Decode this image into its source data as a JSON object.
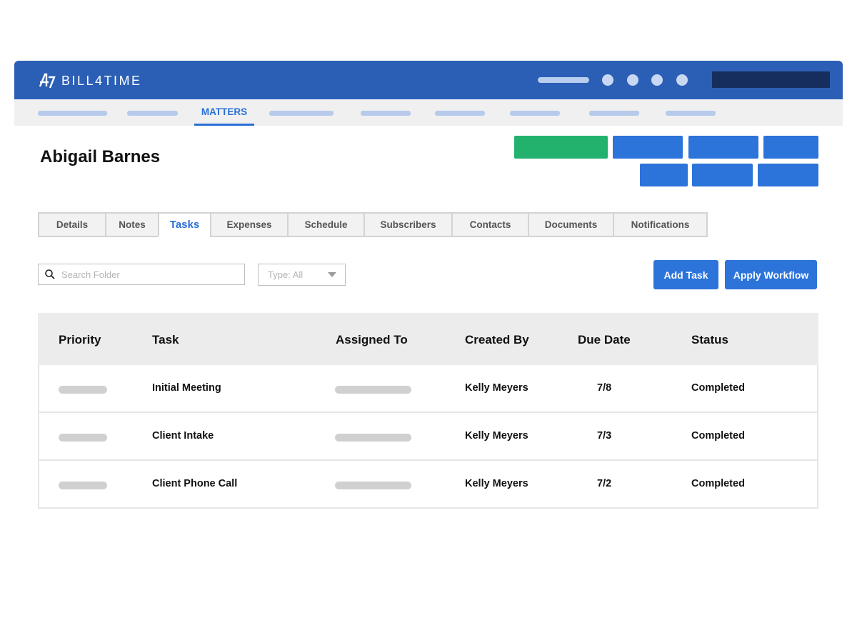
{
  "brand": {
    "name": "BILL4TIME",
    "mark": "b4t-logo-icon",
    "color": "#2b5fb5"
  },
  "nav": {
    "active_label": "MATTERS",
    "active_color": "#2b6fd6"
  },
  "matter": {
    "client_name": "Abigail Barnes"
  },
  "actions": {
    "primary_color": "#23b26d",
    "secondary_color": "#2c73da"
  },
  "tabs": [
    {
      "label": "Details",
      "active": false
    },
    {
      "label": "Notes",
      "active": false
    },
    {
      "label": "Tasks",
      "active": true
    },
    {
      "label": "Expenses",
      "active": false
    },
    {
      "label": "Schedule",
      "active": false
    },
    {
      "label": "Subscribers",
      "active": false
    },
    {
      "label": "Contacts",
      "active": false
    },
    {
      "label": "Documents",
      "active": false
    },
    {
      "label": "Notifications",
      "active": false
    }
  ],
  "search": {
    "placeholder": "Search Folder",
    "icon": "search-icon"
  },
  "type_filter": {
    "value": "Type: All",
    "icon": "caret-down-icon"
  },
  "buttons": {
    "add_task": "Add Task",
    "apply_workflow": "Apply Workflow"
  },
  "table": {
    "headers": [
      "Priority",
      "Task",
      "Assigned To",
      "Created By",
      "Due Date",
      "Status"
    ],
    "rows": [
      {
        "task": "Initial Meeting",
        "created_by": "Kelly Meyers",
        "due_date": "7/8",
        "status": "Completed"
      },
      {
        "task": "Client Intake",
        "created_by": "Kelly Meyers",
        "due_date": "7/3",
        "status": "Completed"
      },
      {
        "task": "Client Phone Call",
        "created_by": "Kelly Meyers",
        "due_date": "7/2",
        "status": "Completed"
      }
    ]
  }
}
